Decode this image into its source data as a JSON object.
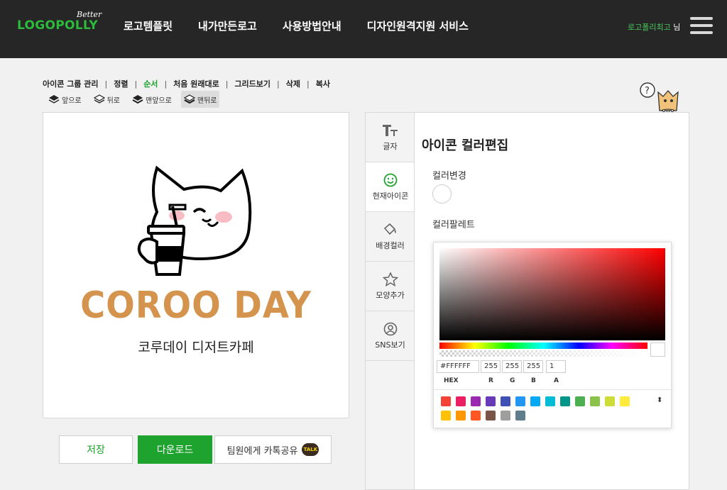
{
  "header": {
    "logo_small": "Better",
    "logo_brand": "LOGOPOLLY",
    "nav": [
      "로고템플릿",
      "내가만든로고",
      "사용방법안내",
      "디자인원격지원 서비스"
    ],
    "user_name": "로고폴리최고",
    "user_suffix": " 님"
  },
  "toolbar": {
    "items": [
      "아이콘 그룹 관리",
      "정렬",
      "순서",
      "처음 원래대로",
      "그리드보기",
      "삭제",
      "복사"
    ],
    "active": "순서",
    "order_buttons": [
      "앞으로",
      "뒤로",
      "맨앞으로",
      "맨뒤로"
    ],
    "order_selected": "맨뒤로"
  },
  "canvas": {
    "logo_title": "COROO DAY",
    "logo_subtitle": "코루데이 디저트카페"
  },
  "actions": {
    "save": "저장",
    "download": "다운로드",
    "kakao": "팀원에게 카톡공유",
    "talk_badge": "TALK"
  },
  "side_tabs": [
    {
      "label": "글자",
      "icon": "text-icon"
    },
    {
      "label": "현재아이콘",
      "icon": "smiley-icon"
    },
    {
      "label": "배경컬러",
      "icon": "paint-bucket-icon"
    },
    {
      "label": "모양추가",
      "icon": "star-icon"
    },
    {
      "label": "SNS보기",
      "icon": "at-icon"
    }
  ],
  "panel": {
    "title": "아이콘 컬러편집",
    "color_change_label": "컬러변경",
    "palette_label": "컬러팔레트",
    "current_color": "#FFFFFF"
  },
  "picker": {
    "hex": "#FFFFFF",
    "r": "255",
    "g": "255",
    "b": "255",
    "a": "1",
    "labels": [
      "HEX",
      "R",
      "G",
      "B",
      "A"
    ],
    "swatches": [
      "#f44336",
      "#e91e63",
      "#9c27b0",
      "#673ab7",
      "#3f51b5",
      "#2196f3",
      "#03a9f4",
      "#00bcd4",
      "#009688",
      "#4caf50",
      "#8bc34a",
      "#cddc39",
      "#ffeb3b",
      "#ffc107",
      "#ff9800",
      "#ff5722",
      "#795548",
      "#9e9e9e",
      "#607d8b"
    ]
  },
  "help": "?",
  "colors": {
    "accent": "#1ea32f",
    "header_bg": "#262626",
    "logo_title": "#d4944e"
  }
}
